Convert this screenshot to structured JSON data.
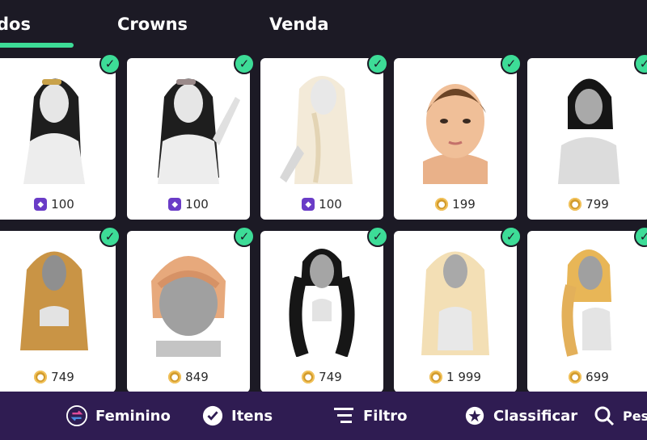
{
  "tabs": [
    {
      "label": "dos"
    },
    {
      "label": "Crowns"
    },
    {
      "label": "Venda"
    }
  ],
  "colors": {
    "accent": "#3ddc97",
    "background": "#1c1a25",
    "bottom_bar": "#2f1c52",
    "gem_currency": "#6a3cc7",
    "coin_currency": "#d19a2b"
  },
  "items": [
    {
      "price": "100",
      "currency": "gem-icon",
      "hair": "black-long-clip"
    },
    {
      "price": "100",
      "currency": "gem-icon",
      "hair": "black-wavy-clip"
    },
    {
      "price": "100",
      "currency": "gem-icon",
      "hair": "platinum-braided-half-up"
    },
    {
      "price": "199",
      "currency": "coin-icon",
      "hair": "brown-short-curly-bangs"
    },
    {
      "price": "799",
      "currency": "coin-icon",
      "hair": "black-short-bob"
    },
    {
      "price": "749",
      "currency": "coin-icon",
      "hair": "honey-wavy-bangs"
    },
    {
      "price": "849",
      "currency": "coin-icon",
      "hair": "strawberry-blonde-bob"
    },
    {
      "price": "749",
      "currency": "coin-icon",
      "hair": "black-twin-tails"
    },
    {
      "price": "1 999",
      "currency": "coin-icon",
      "hair": "blonde-crimped-half-up"
    },
    {
      "price": "699",
      "currency": "coin-icon",
      "hair": "blonde-side-braid"
    }
  ],
  "bottom_bar": {
    "gender_label": "Feminino",
    "items_label": "Itens",
    "filter_label": "Filtro",
    "sort_label": "Classificar",
    "search_label": "Pesqu"
  }
}
